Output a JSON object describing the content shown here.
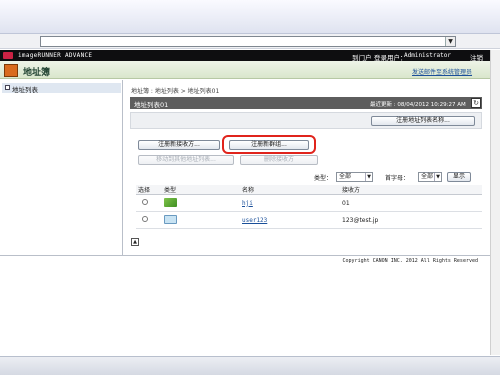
{
  "app": {
    "brand": "imageRUNNER ADVANCE",
    "portal_label": "到门户",
    "login_user_label": "登录用户：",
    "user": "Administrator",
    "logout_label": "注销"
  },
  "title": {
    "text": "地址簿",
    "send_mail_link": "发送邮件至系统管理员"
  },
  "sidebar": {
    "items": [
      {
        "label": "地址列表"
      }
    ]
  },
  "breadcrumb": "地址簿 : 地址列表 > 地址列表01",
  "panel": {
    "name": "地址列表01",
    "last_updated": "最近更新 : 08/04/2012 10:29:27 AM",
    "register_list_name_button": "注册地址列表名称..."
  },
  "buttons": {
    "register_new_recipient": "注册新接收方...",
    "register_new_group": "注册新群组...",
    "move_to_other_list": "移动到其他地址列表...",
    "delete_recipient": "删除接收方"
  },
  "filters": {
    "type_label": "类型：",
    "type_value": "全部",
    "initial_label": "首字母：",
    "initial_value": "全部",
    "display_button": "显示"
  },
  "table": {
    "headers": [
      "选择",
      "类型",
      "名称",
      "接收方"
    ],
    "rows": [
      {
        "type_icon": "group-icon",
        "name": "hji",
        "recipient": "01"
      },
      {
        "type_icon": "email-icon",
        "name": "user123",
        "recipient": "123@test.jp"
      }
    ]
  },
  "footer": {
    "copyright": "Copyright CANON INC. 2012 All Rights Reserved"
  },
  "colors": {
    "highlight": "#e0241c",
    "panel_header": "#5d5d5d",
    "title_green": "#d9e6cc"
  }
}
